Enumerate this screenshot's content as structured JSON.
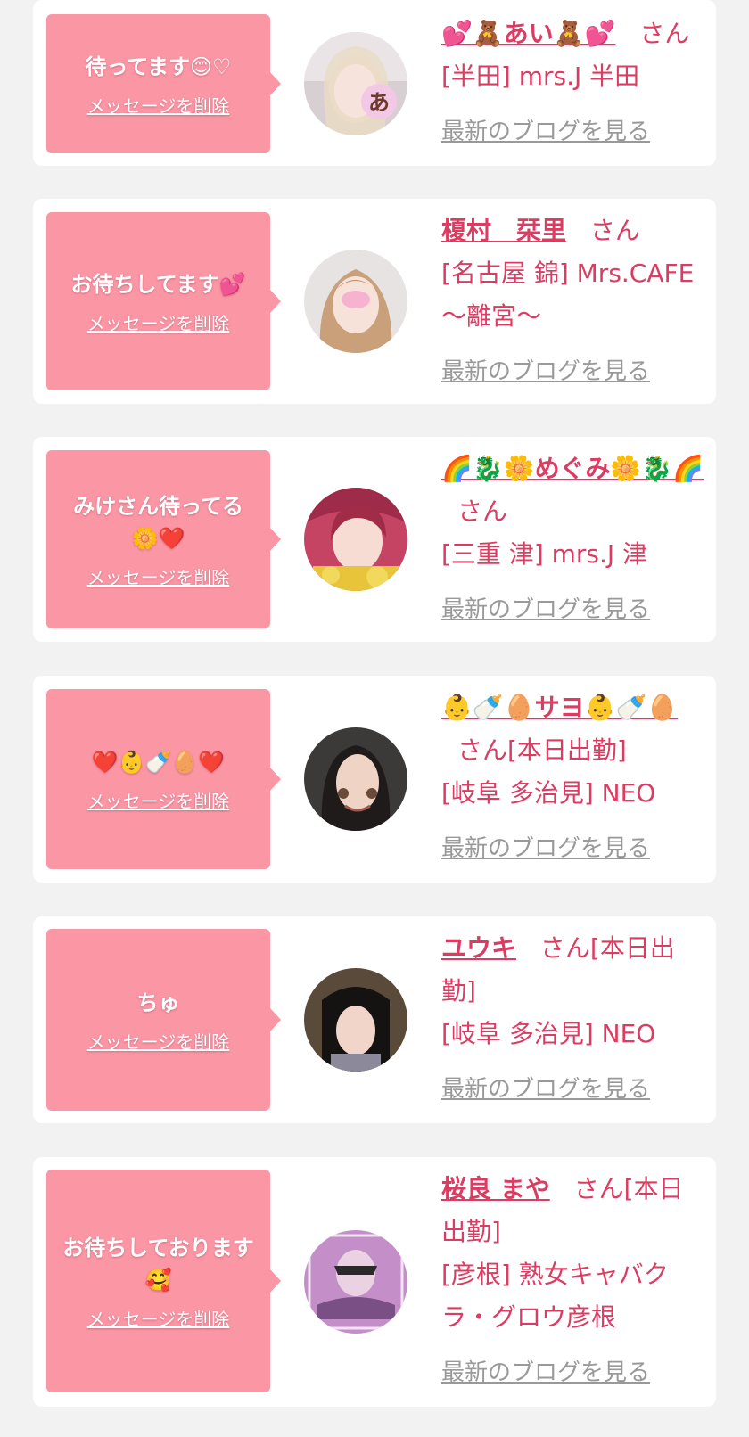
{
  "colors": {
    "page_bg": "#f2f2f2",
    "card_bg": "#ffffff",
    "bubble_bg": "#fb96a5",
    "accent_text": "#dd3c62",
    "blog_link": "#999999"
  },
  "messages": [
    {
      "message": "待ってます😊♡",
      "delete_label": "メッセージを削除",
      "name": "💕🧸あい🧸💕",
      "suffix": "さん",
      "shop": "[半田] mrs.J 半田",
      "blog_label": "最新のブログを見る"
    },
    {
      "message": "お待ちしてます💕",
      "delete_label": "メッセージを削除",
      "name": "榎村　栞里",
      "suffix": "さん",
      "shop": "[名古屋 錦] Mrs.CAFE ～離宮～",
      "blog_label": "最新のブログを見る"
    },
    {
      "message": "みけさん待ってる🌼❤️",
      "delete_label": "メッセージを削除",
      "name": "🌈🐉🌼めぐみ🌼🐉🌈",
      "suffix": "さん",
      "shop": "[三重 津] mrs.J 津",
      "blog_label": "最新のブログを見る"
    },
    {
      "message": "❤️👶🍼🥚❤️",
      "delete_label": "メッセージを削除",
      "name": "👶🍼🥚サヨ👶🍼🥚",
      "suffix": "さん[本日出勤]",
      "shop": "[岐阜 多治見] NEO",
      "blog_label": "最新のブログを見る"
    },
    {
      "message": "ちゅ",
      "delete_label": "メッセージを削除",
      "name": "ユウキ",
      "suffix": "さん[本日出勤]",
      "shop": "[岐阜 多治見] NEO",
      "blog_label": "最新のブログを見る"
    },
    {
      "message": "お待ちしております🥰",
      "delete_label": "メッセージを削除",
      "name": "桜良 まや",
      "suffix": "さん[本日出勤]",
      "shop": "[彦根] 熟女キャバクラ・グロウ彦根",
      "blog_label": "最新のブログを見る"
    }
  ]
}
